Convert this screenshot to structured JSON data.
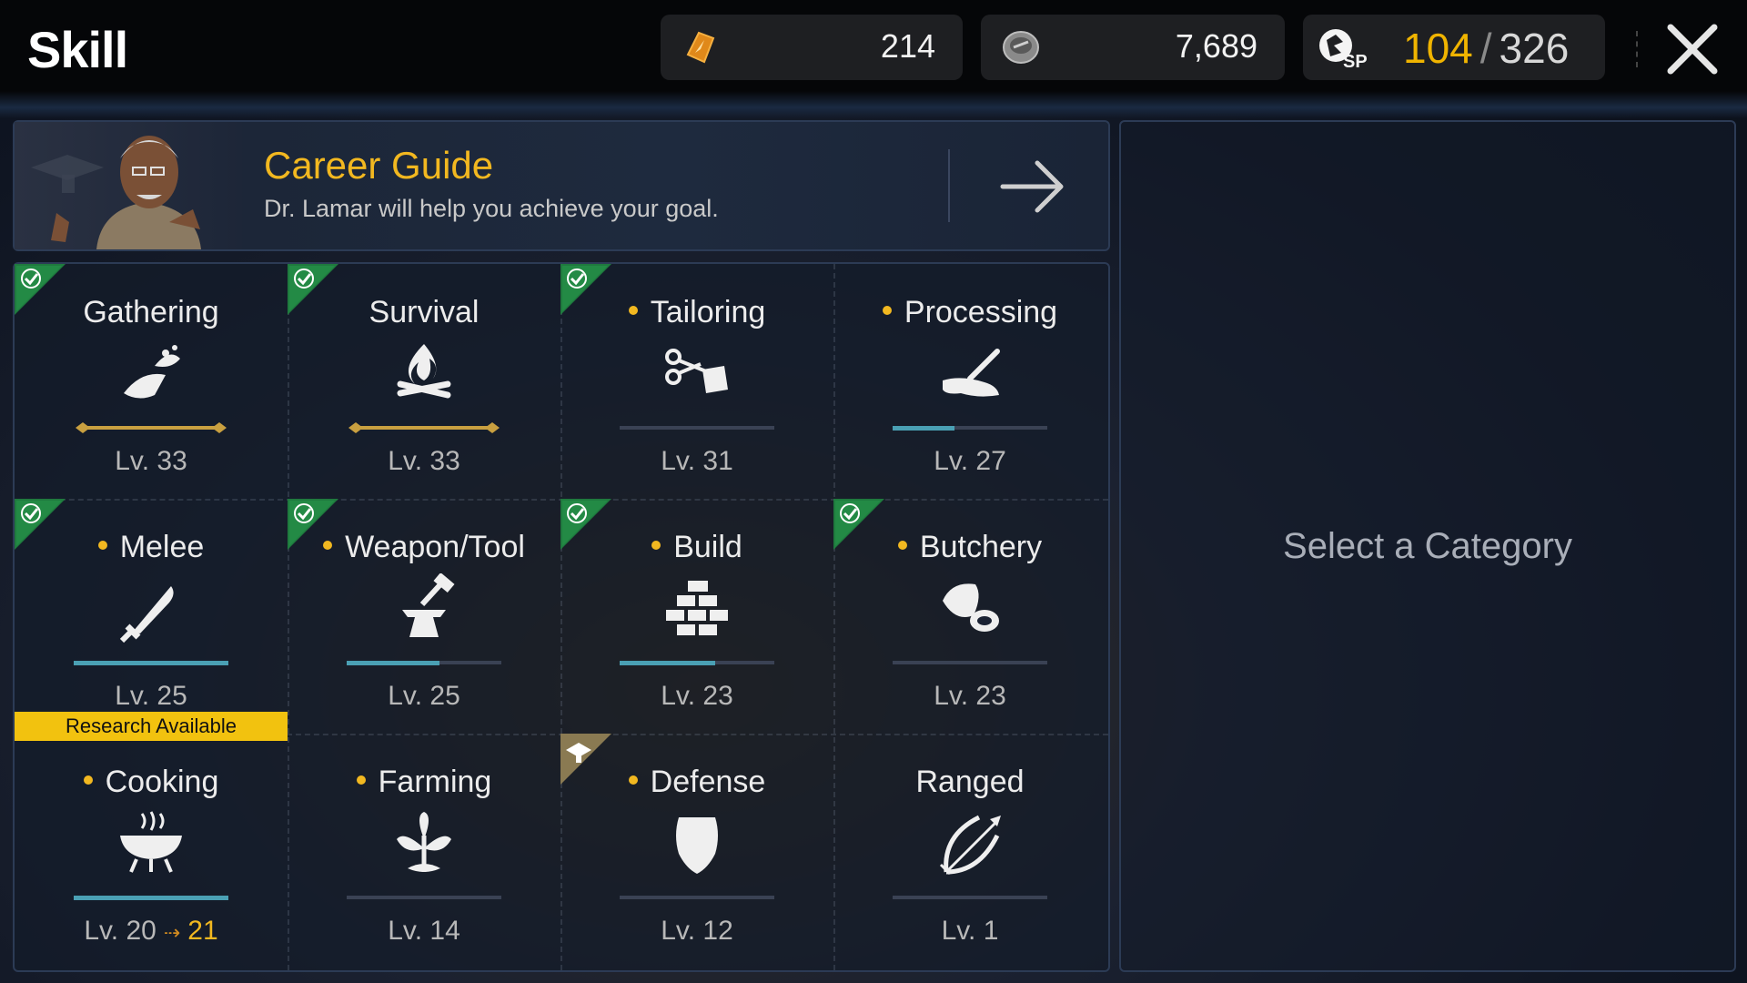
{
  "header": {
    "title": "Skill",
    "resource1": {
      "icon": "energy-shard-icon",
      "value": "214"
    },
    "resource2": {
      "icon": "coin-icon",
      "value": "7,689"
    },
    "skill_points": {
      "icon": "sp-icon",
      "current": "104",
      "separator": "/",
      "max": "326"
    }
  },
  "career_guide": {
    "title": "Career Guide",
    "subtitle": "Dr. Lamar will help you achieve your goal."
  },
  "skills": [
    {
      "name": "Gathering",
      "level": "Lv. 33",
      "dot": false,
      "badge": "check",
      "progress": 1.0,
      "maxed": true,
      "icon": "gathering-icon"
    },
    {
      "name": "Survival",
      "level": "Lv. 33",
      "dot": false,
      "badge": "check",
      "progress": 1.0,
      "maxed": true,
      "icon": "campfire-icon"
    },
    {
      "name": "Tailoring",
      "level": "Lv. 31",
      "dot": true,
      "badge": "check",
      "progress": 0.0,
      "icon": "scissors-icon"
    },
    {
      "name": "Processing",
      "level": "Lv. 27",
      "dot": true,
      "badge": "",
      "progress": 0.4,
      "icon": "processing-icon"
    },
    {
      "name": "Melee",
      "level": "Lv. 25",
      "dot": true,
      "badge": "check",
      "progress": 1.0,
      "icon": "blade-icon",
      "research": "Research Available"
    },
    {
      "name": "Weapon/Tool",
      "level": "Lv. 25",
      "dot": true,
      "badge": "check",
      "progress": 0.6,
      "icon": "anvil-icon"
    },
    {
      "name": "Build",
      "level": "Lv. 23",
      "dot": true,
      "badge": "check",
      "progress": 0.62,
      "icon": "bricks-icon"
    },
    {
      "name": "Butchery",
      "level": "Lv. 23",
      "dot": true,
      "badge": "check",
      "progress": 0.0,
      "icon": "meat-icon"
    },
    {
      "name": "Cooking",
      "level": "Lv. 20",
      "next_level": "21",
      "dot": true,
      "badge": "",
      "progress": 1.0,
      "icon": "cooking-pot-icon"
    },
    {
      "name": "Farming",
      "level": "Lv. 14",
      "dot": true,
      "badge": "",
      "progress": 0.0,
      "icon": "plant-icon"
    },
    {
      "name": "Defense",
      "level": "Lv. 12",
      "dot": true,
      "badge": "career",
      "progress": 0.0,
      "icon": "shield-icon"
    },
    {
      "name": "Ranged",
      "level": "Lv. 1",
      "dot": false,
      "badge": "",
      "progress": 0.0,
      "icon": "bow-icon"
    }
  ],
  "right_panel": {
    "hint": "Select a Category"
  },
  "colors": {
    "accent": "#f2b820",
    "progress": "#4aa0b4",
    "badge_green": "#1f7a3e"
  }
}
